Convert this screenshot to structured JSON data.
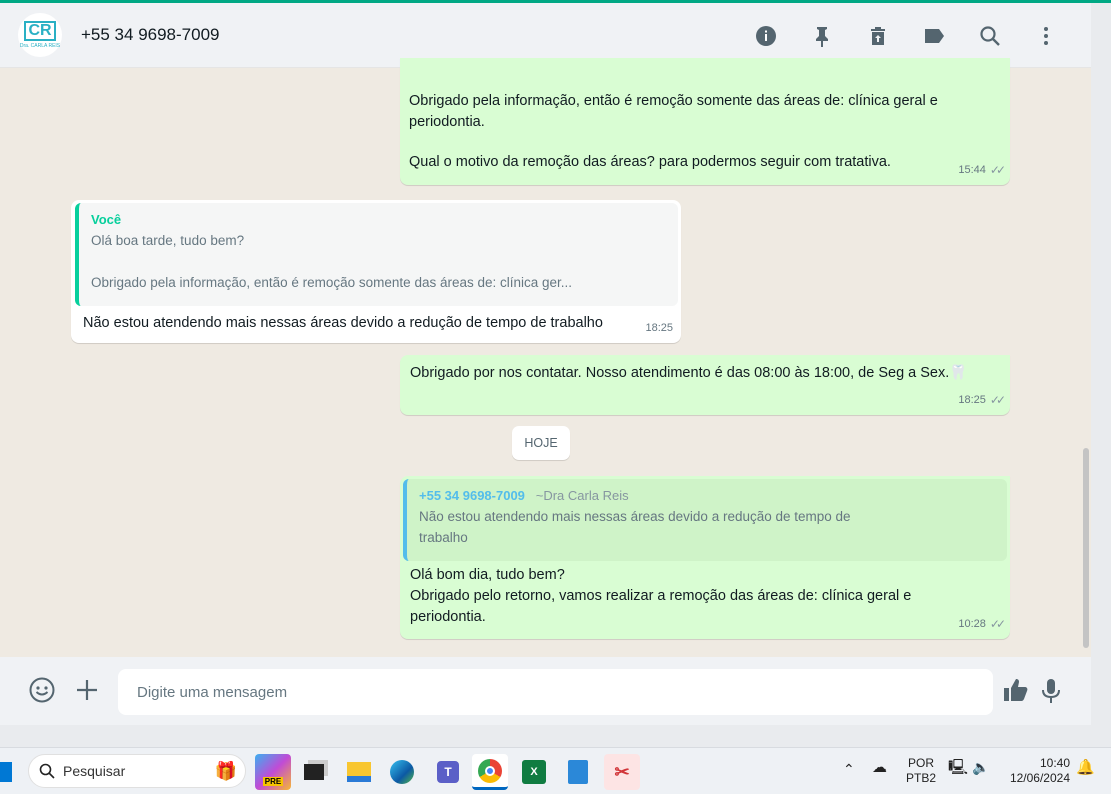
{
  "header": {
    "title": "+55 34 9698-7009",
    "avatar_text": "CR",
    "avatar_subtext": "Dra. CARLA REIS",
    "icons": [
      "info-icon",
      "pin-icon",
      "delete-icon",
      "label-icon",
      "search-icon",
      "more-icon"
    ]
  },
  "messages": [
    {
      "type": "out",
      "lines": [
        "Obrigado pela informação, então é remoção somente das áreas de: clínica geral e",
        "periodontia.",
        "",
        "Qual o motivo da remoção das áreas? para podermos seguir com tratativa."
      ],
      "time": "15:44"
    },
    {
      "type": "in",
      "quote_author": "Você",
      "quote_line1": "Olá boa tarde, tudo bem?",
      "quote_line2": "Obrigado pela informação, então é remoção somente das áreas de: clínica ger...",
      "text": "Não estou atendendo mais nessas áreas devido a redução de tempo de trabalho",
      "time": "18:25"
    },
    {
      "type": "out",
      "text": "Obrigado por nos contatar. Nosso atendimento é das 08:00 às 18:00, de Seg a Sex.",
      "emoji": "🦷",
      "time": "18:25"
    },
    {
      "type": "out",
      "quote_author": "+55 34 9698-7009",
      "quote_pushname": "~Dra Carla Reis",
      "quote_line1": "Não estou atendendo mais nessas áreas devido a redução de tempo de",
      "quote_line2": "trabalho",
      "lines": [
        "Olá bom dia, tudo bem?",
        "Obrigado pelo retorno, vamos realizar a remoção das áreas de: clínica geral e",
        "periodontia."
      ],
      "time": "10:28"
    }
  ],
  "date_chip": "HOJE",
  "composer": {
    "placeholder": "Digite uma mensagem"
  },
  "taskbar": {
    "search_label": "Pesquisar",
    "lang_line1": "POR",
    "lang_line2": "PTB2",
    "clock_time": "10:40",
    "clock_date": "12/06/2024",
    "copilot_badge": "PRE"
  },
  "colors": {
    "accent": "#00a884",
    "outgoing": "#d9fdd3",
    "incoming": "#ffffff",
    "quote_you": "#06cf9c",
    "quote_contact": "#53bdeb"
  }
}
